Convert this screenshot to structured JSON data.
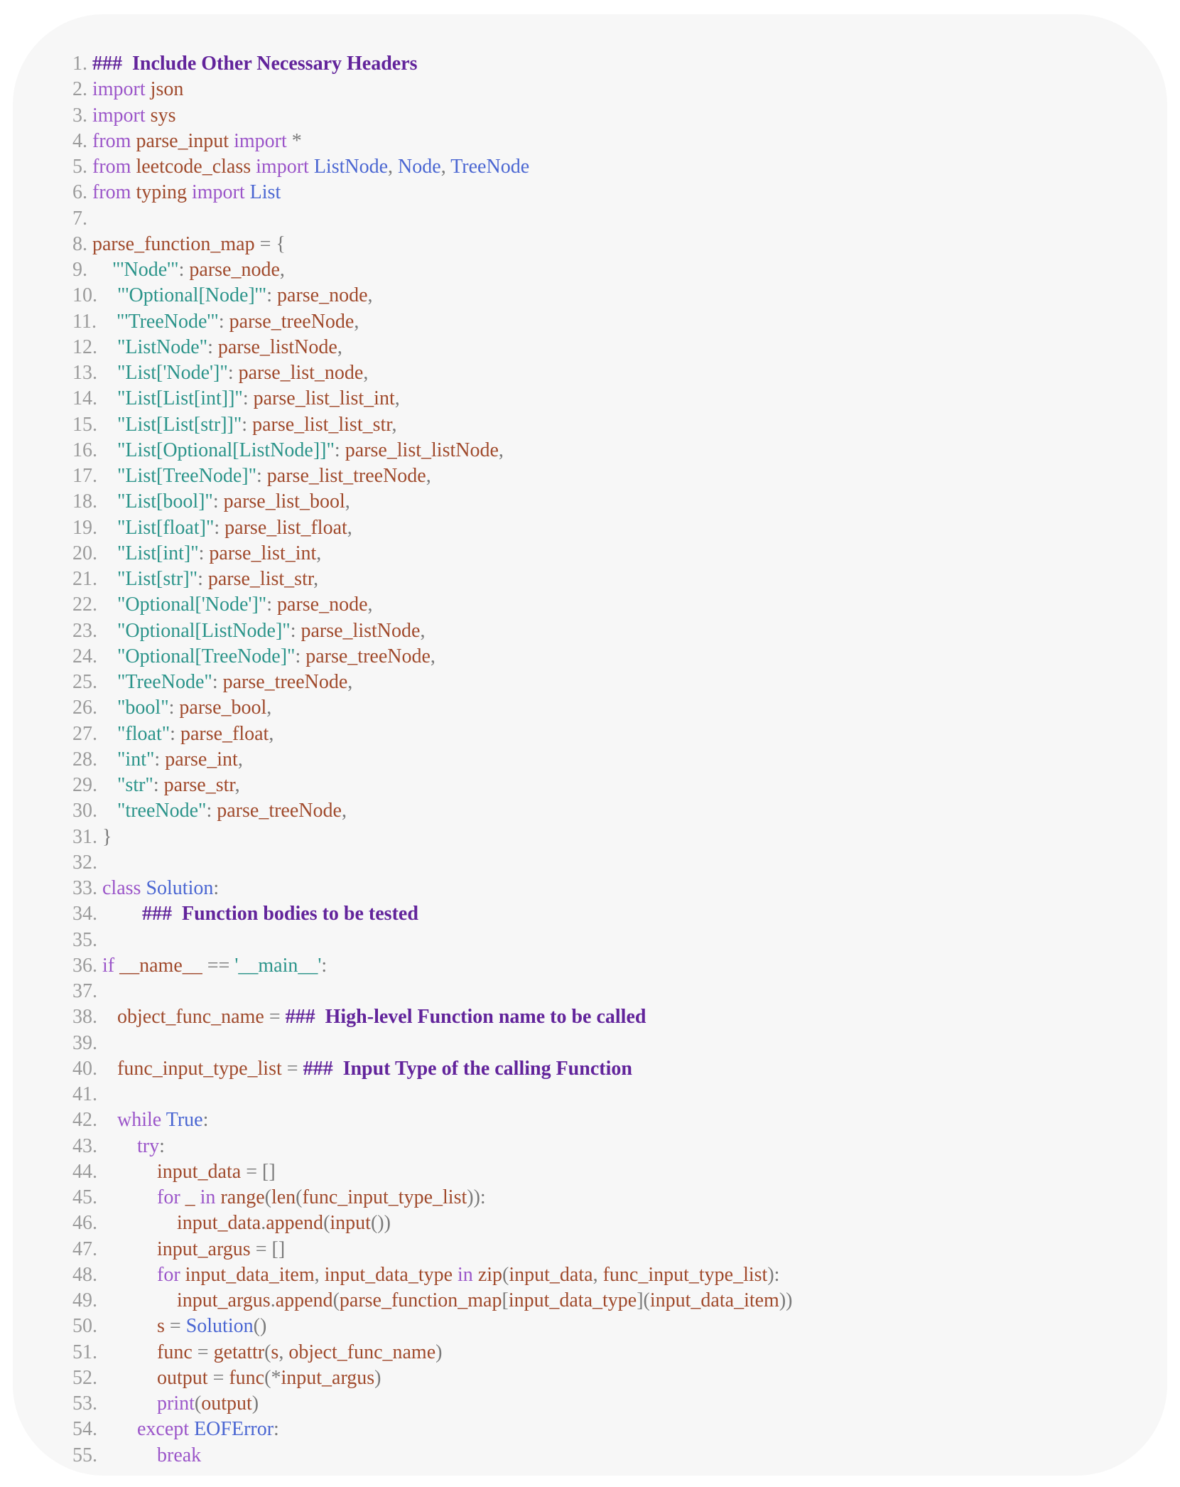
{
  "colors": {
    "line_number": "#9b9b9b",
    "keyword": "#9b55c9",
    "identifier": "#a04a2c",
    "string": "#2b948a",
    "class_name": "#4a66d2",
    "punctuation": "#7a7a7a",
    "placeholder": "#62249b",
    "panel_background": "#f7f7f7"
  },
  "lines": [
    [
      [
        "ln",
        "1. "
      ],
      [
        "ph",
        "###  Include Other Necessary Headers"
      ]
    ],
    [
      [
        "ln",
        "2. "
      ],
      [
        "kw",
        "import "
      ],
      [
        "id",
        "json"
      ]
    ],
    [
      [
        "ln",
        "3. "
      ],
      [
        "kw",
        "import "
      ],
      [
        "id",
        "sys"
      ]
    ],
    [
      [
        "ln",
        "4. "
      ],
      [
        "kw",
        "from "
      ],
      [
        "id",
        "parse_input "
      ],
      [
        "kw",
        "import "
      ],
      [
        "op",
        "*"
      ]
    ],
    [
      [
        "ln",
        "5. "
      ],
      [
        "kw",
        "from "
      ],
      [
        "id",
        "leetcode_class "
      ],
      [
        "kw",
        "import "
      ],
      [
        "cls",
        "ListNode"
      ],
      [
        "op",
        ", "
      ],
      [
        "cls",
        "Node"
      ],
      [
        "op",
        ", "
      ],
      [
        "cls",
        "TreeNode"
      ]
    ],
    [
      [
        "ln",
        "6. "
      ],
      [
        "kw",
        "from "
      ],
      [
        "id",
        "typing "
      ],
      [
        "kw",
        "import "
      ],
      [
        "cls",
        "List"
      ]
    ],
    [
      [
        "ln",
        "7. "
      ]
    ],
    [
      [
        "ln",
        "8. "
      ],
      [
        "id",
        "parse_function_map "
      ],
      [
        "op",
        "= {"
      ]
    ],
    [
      [
        "ln",
        "9.     "
      ],
      [
        "str",
        "\"'Node'\""
      ],
      [
        "op",
        ": "
      ],
      [
        "id",
        "parse_node"
      ],
      [
        "op",
        ","
      ]
    ],
    [
      [
        "ln",
        "10.    "
      ],
      [
        "str",
        "\"'Optional[Node]'\""
      ],
      [
        "op",
        ": "
      ],
      [
        "id",
        "parse_node"
      ],
      [
        "op",
        ","
      ]
    ],
    [
      [
        "ln",
        "11.    "
      ],
      [
        "str",
        "\"'TreeNode'\""
      ],
      [
        "op",
        ": "
      ],
      [
        "id",
        "parse_treeNode"
      ],
      [
        "op",
        ","
      ]
    ],
    [
      [
        "ln",
        "12.    "
      ],
      [
        "str",
        "\"ListNode\""
      ],
      [
        "op",
        ": "
      ],
      [
        "id",
        "parse_listNode"
      ],
      [
        "op",
        ","
      ]
    ],
    [
      [
        "ln",
        "13.    "
      ],
      [
        "str",
        "\"List['Node']\""
      ],
      [
        "op",
        ": "
      ],
      [
        "id",
        "parse_list_node"
      ],
      [
        "op",
        ","
      ]
    ],
    [
      [
        "ln",
        "14.    "
      ],
      [
        "str",
        "\"List[List[int]]\""
      ],
      [
        "op",
        ": "
      ],
      [
        "id",
        "parse_list_list_int"
      ],
      [
        "op",
        ","
      ]
    ],
    [
      [
        "ln",
        "15.    "
      ],
      [
        "str",
        "\"List[List[str]]\""
      ],
      [
        "op",
        ": "
      ],
      [
        "id",
        "parse_list_list_str"
      ],
      [
        "op",
        ","
      ]
    ],
    [
      [
        "ln",
        "16.    "
      ],
      [
        "str",
        "\"List[Optional[ListNode]]\""
      ],
      [
        "op",
        ": "
      ],
      [
        "id",
        "parse_list_listNode"
      ],
      [
        "op",
        ","
      ]
    ],
    [
      [
        "ln",
        "17.    "
      ],
      [
        "str",
        "\"List[TreeNode]\""
      ],
      [
        "op",
        ": "
      ],
      [
        "id",
        "parse_list_treeNode"
      ],
      [
        "op",
        ","
      ]
    ],
    [
      [
        "ln",
        "18.    "
      ],
      [
        "str",
        "\"List[bool]\""
      ],
      [
        "op",
        ": "
      ],
      [
        "id",
        "parse_list_bool"
      ],
      [
        "op",
        ","
      ]
    ],
    [
      [
        "ln",
        "19.    "
      ],
      [
        "str",
        "\"List[float]\""
      ],
      [
        "op",
        ": "
      ],
      [
        "id",
        "parse_list_float"
      ],
      [
        "op",
        ","
      ]
    ],
    [
      [
        "ln",
        "20.    "
      ],
      [
        "str",
        "\"List[int]\""
      ],
      [
        "op",
        ": "
      ],
      [
        "id",
        "parse_list_int"
      ],
      [
        "op",
        ","
      ]
    ],
    [
      [
        "ln",
        "21.    "
      ],
      [
        "str",
        "\"List[str]\""
      ],
      [
        "op",
        ": "
      ],
      [
        "id",
        "parse_list_str"
      ],
      [
        "op",
        ","
      ]
    ],
    [
      [
        "ln",
        "22.    "
      ],
      [
        "str",
        "\"Optional['Node']\""
      ],
      [
        "op",
        ": "
      ],
      [
        "id",
        "parse_node"
      ],
      [
        "op",
        ","
      ]
    ],
    [
      [
        "ln",
        "23.    "
      ],
      [
        "str",
        "\"Optional[ListNode]\""
      ],
      [
        "op",
        ": "
      ],
      [
        "id",
        "parse_listNode"
      ],
      [
        "op",
        ","
      ]
    ],
    [
      [
        "ln",
        "24.    "
      ],
      [
        "str",
        "\"Optional[TreeNode]\""
      ],
      [
        "op",
        ": "
      ],
      [
        "id",
        "parse_treeNode"
      ],
      [
        "op",
        ","
      ]
    ],
    [
      [
        "ln",
        "25.    "
      ],
      [
        "str",
        "\"TreeNode\""
      ],
      [
        "op",
        ": "
      ],
      [
        "id",
        "parse_treeNode"
      ],
      [
        "op",
        ","
      ]
    ],
    [
      [
        "ln",
        "26.    "
      ],
      [
        "str",
        "\"bool\""
      ],
      [
        "op",
        ": "
      ],
      [
        "id",
        "parse_bool"
      ],
      [
        "op",
        ","
      ]
    ],
    [
      [
        "ln",
        "27.    "
      ],
      [
        "str",
        "\"float\""
      ],
      [
        "op",
        ": "
      ],
      [
        "id",
        "parse_float"
      ],
      [
        "op",
        ","
      ]
    ],
    [
      [
        "ln",
        "28.    "
      ],
      [
        "str",
        "\"int\""
      ],
      [
        "op",
        ": "
      ],
      [
        "id",
        "parse_int"
      ],
      [
        "op",
        ","
      ]
    ],
    [
      [
        "ln",
        "29.    "
      ],
      [
        "str",
        "\"str\""
      ],
      [
        "op",
        ": "
      ],
      [
        "id",
        "parse_str"
      ],
      [
        "op",
        ","
      ]
    ],
    [
      [
        "ln",
        "30.    "
      ],
      [
        "str",
        "\"treeNode\""
      ],
      [
        "op",
        ": "
      ],
      [
        "id",
        "parse_treeNode"
      ],
      [
        "op",
        ","
      ]
    ],
    [
      [
        "ln",
        "31. "
      ],
      [
        "op",
        "}"
      ]
    ],
    [
      [
        "ln",
        "32. "
      ]
    ],
    [
      [
        "ln",
        "33. "
      ],
      [
        "kw",
        "class "
      ],
      [
        "cls",
        "Solution"
      ],
      [
        "op",
        ":"
      ]
    ],
    [
      [
        "ln",
        "34.         "
      ],
      [
        "ph",
        "###  Function bodies to be tested"
      ]
    ],
    [
      [
        "ln",
        "35. "
      ]
    ],
    [
      [
        "ln",
        "36. "
      ],
      [
        "kw",
        "if "
      ],
      [
        "id",
        "__name__ "
      ],
      [
        "op",
        "== "
      ],
      [
        "str",
        "'__main__'"
      ],
      [
        "op",
        ":"
      ]
    ],
    [
      [
        "ln",
        "37. "
      ]
    ],
    [
      [
        "ln",
        "38.    "
      ],
      [
        "id",
        "object_func_name "
      ],
      [
        "op",
        "= "
      ],
      [
        "ph",
        "###  High-level Function name to be called"
      ]
    ],
    [
      [
        "ln",
        "39. "
      ]
    ],
    [
      [
        "ln",
        "40.    "
      ],
      [
        "id",
        "func_input_type_list "
      ],
      [
        "op",
        "= "
      ],
      [
        "ph",
        "###  Input Type of the calling Function"
      ]
    ],
    [
      [
        "ln",
        "41. "
      ]
    ],
    [
      [
        "ln",
        "42.    "
      ],
      [
        "kw",
        "while "
      ],
      [
        "cls",
        "True"
      ],
      [
        "op",
        ":"
      ]
    ],
    [
      [
        "ln",
        "43.        "
      ],
      [
        "kw",
        "try"
      ],
      [
        "op",
        ":"
      ]
    ],
    [
      [
        "ln",
        "44.            "
      ],
      [
        "id",
        "input_data "
      ],
      [
        "op",
        "= []"
      ]
    ],
    [
      [
        "ln",
        "45.            "
      ],
      [
        "kw",
        "for "
      ],
      [
        "id",
        "_ "
      ],
      [
        "kw",
        "in "
      ],
      [
        "id",
        "range"
      ],
      [
        "op",
        "("
      ],
      [
        "id",
        "len"
      ],
      [
        "op",
        "("
      ],
      [
        "id",
        "func_input_type_list"
      ],
      [
        "op",
        "))"
      ],
      [
        "op",
        ":"
      ]
    ],
    [
      [
        "ln",
        "46.                "
      ],
      [
        "id",
        "input_data"
      ],
      [
        "op",
        "."
      ],
      [
        "id",
        "append"
      ],
      [
        "op",
        "("
      ],
      [
        "id",
        "input"
      ],
      [
        "op",
        "())"
      ]
    ],
    [
      [
        "ln",
        "47.            "
      ],
      [
        "id",
        "input_argus "
      ],
      [
        "op",
        "= []"
      ]
    ],
    [
      [
        "ln",
        "48.            "
      ],
      [
        "kw",
        "for "
      ],
      [
        "id",
        "input_data_item"
      ],
      [
        "op",
        ", "
      ],
      [
        "id",
        "input_data_type "
      ],
      [
        "kw",
        "in "
      ],
      [
        "id",
        "zip"
      ],
      [
        "op",
        "("
      ],
      [
        "id",
        "input_data"
      ],
      [
        "op",
        ", "
      ],
      [
        "id",
        "func_input_type_list"
      ],
      [
        "op",
        "):"
      ]
    ],
    [
      [
        "ln",
        "49.                "
      ],
      [
        "id",
        "input_argus"
      ],
      [
        "op",
        "."
      ],
      [
        "id",
        "append"
      ],
      [
        "op",
        "("
      ],
      [
        "id",
        "parse_function_map"
      ],
      [
        "op",
        "["
      ],
      [
        "id",
        "input_data_type"
      ],
      [
        "op",
        "]("
      ],
      [
        "id",
        "input_data_item"
      ],
      [
        "op",
        "))"
      ]
    ],
    [
      [
        "ln",
        "50.            "
      ],
      [
        "id",
        "s "
      ],
      [
        "op",
        "= "
      ],
      [
        "cls",
        "Solution"
      ],
      [
        "op",
        "()"
      ]
    ],
    [
      [
        "ln",
        "51.            "
      ],
      [
        "id",
        "func "
      ],
      [
        "op",
        "= "
      ],
      [
        "id",
        "getattr"
      ],
      [
        "op",
        "("
      ],
      [
        "id",
        "s"
      ],
      [
        "op",
        ", "
      ],
      [
        "id",
        "object_func_name"
      ],
      [
        "op",
        ")"
      ]
    ],
    [
      [
        "ln",
        "52.            "
      ],
      [
        "id",
        "output "
      ],
      [
        "op",
        "= "
      ],
      [
        "id",
        "func"
      ],
      [
        "op",
        "(*"
      ],
      [
        "id",
        "input_argus"
      ],
      [
        "op",
        ")"
      ]
    ],
    [
      [
        "ln",
        "53.            "
      ],
      [
        "kw",
        "print"
      ],
      [
        "op",
        "("
      ],
      [
        "id",
        "output"
      ],
      [
        "op",
        ")"
      ]
    ],
    [
      [
        "ln",
        "54.        "
      ],
      [
        "kw",
        "except "
      ],
      [
        "cls",
        "EOFError"
      ],
      [
        "op",
        ":"
      ]
    ],
    [
      [
        "ln",
        "55.            "
      ],
      [
        "kw",
        "break"
      ]
    ]
  ]
}
